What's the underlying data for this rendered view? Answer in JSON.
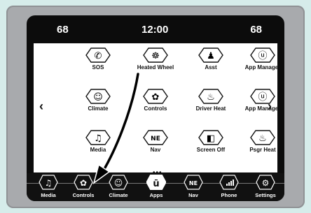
{
  "status": {
    "left_temp": "68",
    "time": "12:00",
    "right_temp": "68"
  },
  "nav": {
    "prev": "‹",
    "next": "›",
    "page_indicator": "•••"
  },
  "apps": [
    {
      "label": "SOS",
      "icon": "phone-icon"
    },
    {
      "label": "Heated Wheel",
      "icon": "steering-wheel-icon"
    },
    {
      "label": "Asst",
      "icon": "assist-person-icon"
    },
    {
      "label": "App Manager",
      "icon": "app-manager-icon"
    },
    {
      "label": "Climate",
      "icon": "climate-icon"
    },
    {
      "label": "Controls",
      "icon": "controls-icon"
    },
    {
      "label": "Driver Heat",
      "icon": "seat-heat-icon"
    },
    {
      "label": "App Manager",
      "icon": "app-manager-icon"
    },
    {
      "label": "Media",
      "icon": "music-note-icon"
    },
    {
      "label": "Nav",
      "icon": "compass-icon"
    },
    {
      "label": "Screen Off",
      "icon": "screen-off-icon"
    },
    {
      "label": "Psgr Heat",
      "icon": "seat-heat-icon"
    }
  ],
  "dock": [
    {
      "label": "Media",
      "icon": "music-note-icon"
    },
    {
      "label": "Controls",
      "icon": "controls-icon"
    },
    {
      "label": "Climate",
      "icon": "climate-icon"
    },
    {
      "label": "Apps",
      "icon": "apps-u-icon"
    },
    {
      "label": "Nav",
      "icon": "compass-icon"
    },
    {
      "label": "Phone",
      "icon": "phone-signal-icon"
    },
    {
      "label": "Settings",
      "icon": "gear-icon"
    }
  ],
  "glyphs": {
    "phone": "✆",
    "wheel": "☸",
    "person": "♟",
    "app": "ⓤ",
    "climate": "☺",
    "controls": "✿",
    "seat": "♨",
    "music": "♫",
    "nav": "NE",
    "screen": "◧",
    "gear": "⚙",
    "u": "ū"
  }
}
